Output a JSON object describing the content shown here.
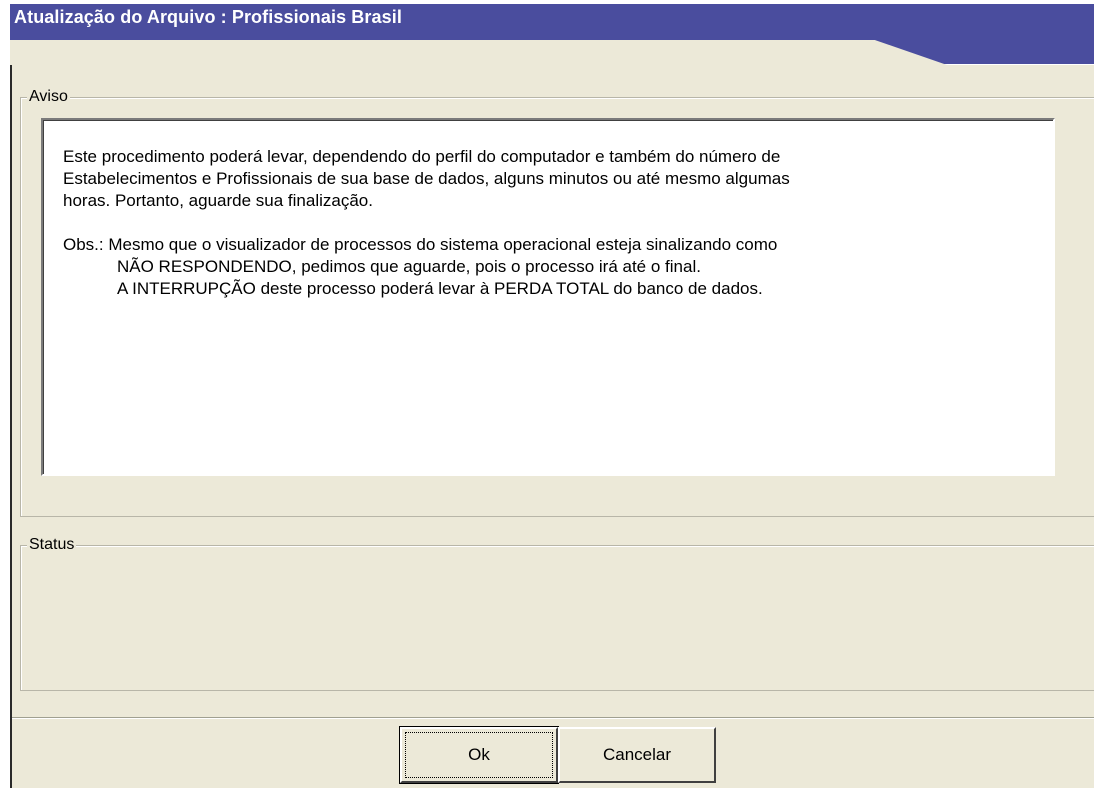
{
  "window": {
    "title": "Atualização do Arquivo : Profissionais Brasil"
  },
  "aviso": {
    "label": "Aviso",
    "paragraph1": [
      "Este procedimento poderá levar, dependendo do perfil  do computador e também do número de",
      "Estabelecimentos e Profissionais de sua base de dados, alguns minutos ou até mesmo algumas",
      "horas. Portanto, aguarde sua finalização."
    ],
    "obs": [
      "Obs.: Mesmo que o visualizador de processos do sistema operacional esteja sinalizando como",
      "NÃO RESPONDENDO, pedimos que aguarde, pois o processo irá até o final.",
      "A INTERRUPÇÃO deste processo poderá levar à PERDA TOTAL do banco de dados."
    ]
  },
  "status": {
    "label": "Status"
  },
  "buttons": {
    "ok_label": "Ok",
    "cancel_label": "Cancelar"
  },
  "colors": {
    "titlebar": "#4a4d9e",
    "face": "#ece9d8"
  }
}
